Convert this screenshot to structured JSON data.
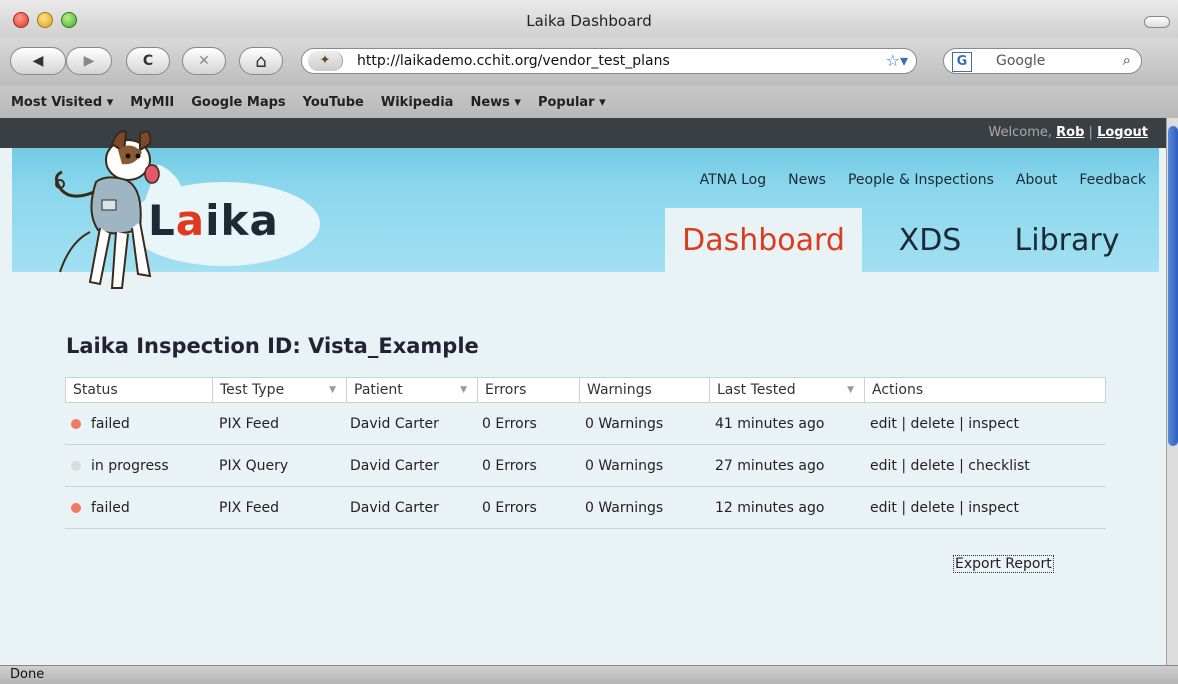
{
  "window": {
    "title": "Laika Dashboard"
  },
  "toolbar": {
    "url": "http://laikademo.cchit.org/vendor_test_plans",
    "search_placeholder": "Google",
    "back": "◀",
    "forward": "▶",
    "reload": "C",
    "stop": "✕",
    "home": "⌂"
  },
  "bookmarks": [
    "Most Visited ▾",
    "MyMII",
    "Google Maps",
    "YouTube",
    "Wikipedia",
    "News ▾",
    "Popular ▾"
  ],
  "header": {
    "welcome": "Welcome,",
    "user": "Rob",
    "separator": "|",
    "logout": "Logout",
    "logo": {
      "pre": "L",
      "accent": "a",
      "post": "ika"
    },
    "topnav": [
      "ATNA Log",
      "News",
      "People & Inspections",
      "About",
      "Feedback"
    ],
    "tabs": [
      "Dashboard",
      "XDS",
      "Library"
    ]
  },
  "main": {
    "heading": "Laika Inspection ID: Vista_Example",
    "columns": [
      "Status",
      "Test Type",
      "Patient",
      "Errors",
      "Warnings",
      "Last Tested",
      "Actions"
    ],
    "rows": [
      {
        "status": "failed",
        "status_color": "#f07a63",
        "test_type": "PIX Feed",
        "patient": "David Carter",
        "errors": "0 Errors",
        "warnings": "0 Warnings",
        "last_tested": "41 minutes ago",
        "actions": [
          "edit",
          "delete",
          "inspect"
        ]
      },
      {
        "status": "in progress",
        "status_color": "#d9dcdd",
        "test_type": "PIX Query",
        "patient": "David Carter",
        "errors": "0 Errors",
        "warnings": "0 Warnings",
        "last_tested": "27 minutes ago",
        "actions": [
          "edit",
          "delete",
          "checklist"
        ]
      },
      {
        "status": "failed",
        "status_color": "#f07a63",
        "test_type": "PIX Feed",
        "patient": "David Carter",
        "errors": "0 Errors",
        "warnings": "0 Warnings",
        "last_tested": "12 minutes ago",
        "actions": [
          "edit",
          "delete",
          "inspect"
        ]
      }
    ],
    "export": "Export Report"
  },
  "statusbar": {
    "text": "Done"
  },
  "colors": {
    "accent": "#dd3b1e",
    "banner": "#8ad6ec",
    "page": "#e9f2f4"
  }
}
